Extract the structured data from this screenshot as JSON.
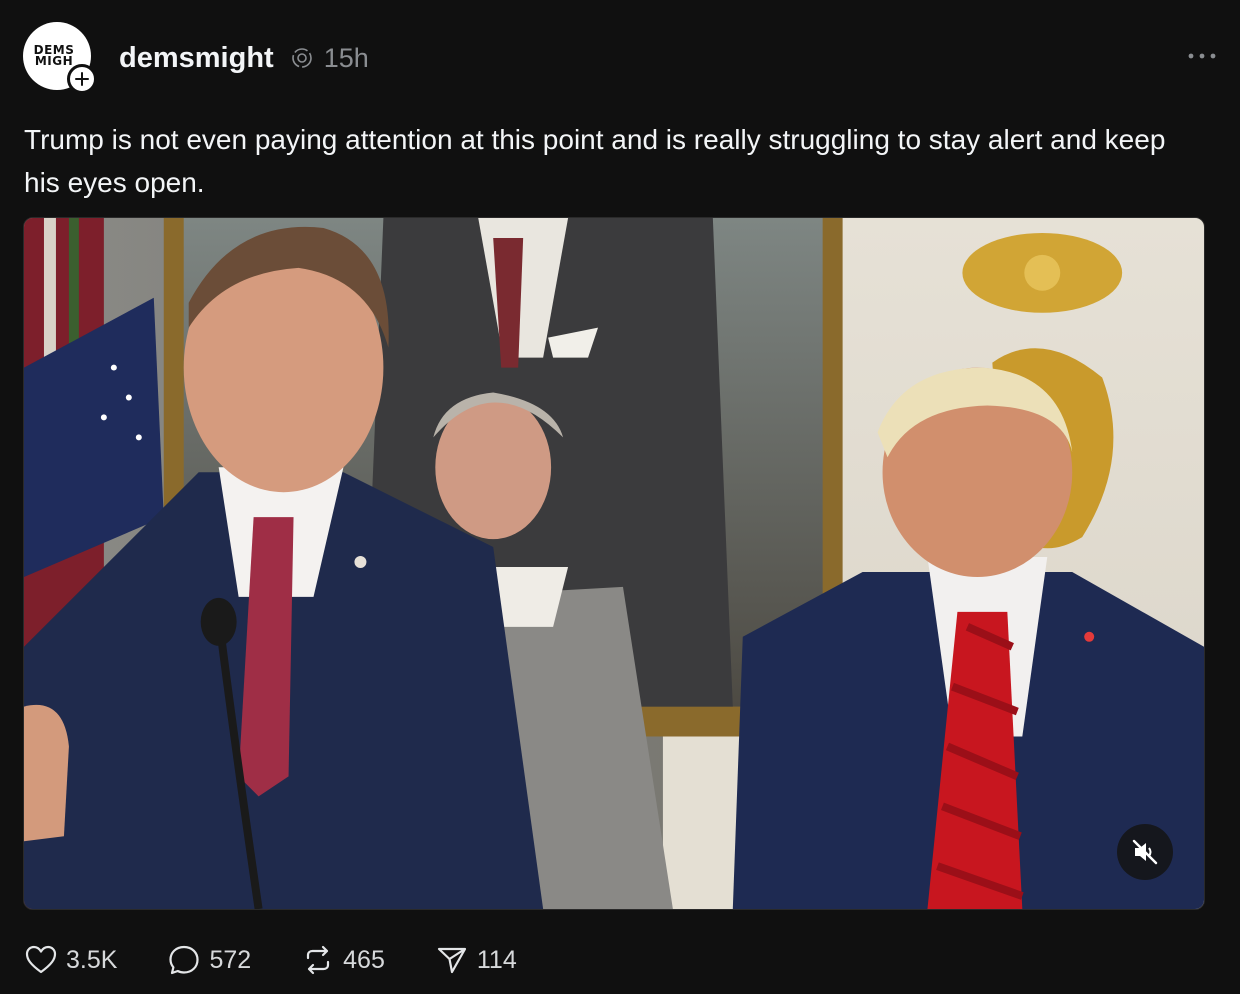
{
  "post": {
    "avatar_text": "DEMS\nMIGH",
    "username": "demsmight",
    "time": "15h",
    "text": "Trump is not even paying attention at this point and is really struggling to stay alert and keep his eyes open.",
    "more_icon": "more-horizontal-icon",
    "repost_badge_icon": "reposted-icon"
  },
  "media": {
    "type": "video",
    "muted": true,
    "mute_icon": "speaker-muted-icon"
  },
  "actions": {
    "like_count": "3.5K",
    "reply_count": "572",
    "repost_count": "465",
    "share_count": "114",
    "like_icon": "heart-icon",
    "reply_icon": "comment-bubble-icon",
    "repost_icon": "repost-icon",
    "share_icon": "send-icon"
  },
  "colors": {
    "background": "#101010",
    "text_primary": "#f3f5f7",
    "text_secondary": "#8a8d91"
  }
}
